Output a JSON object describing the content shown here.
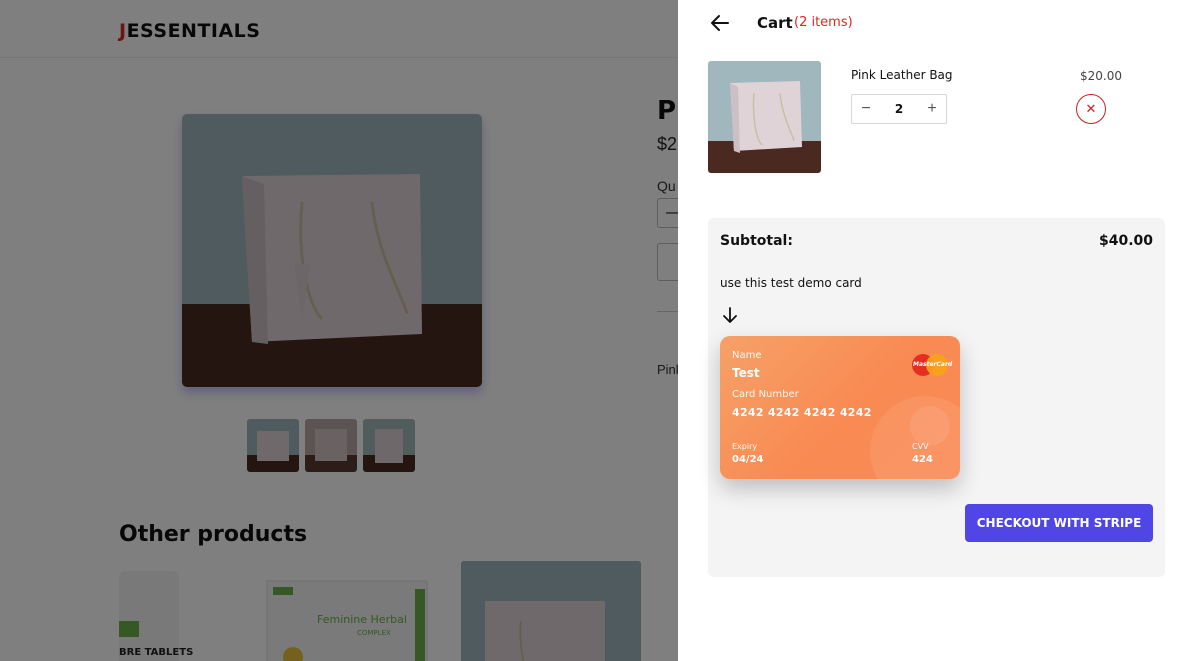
{
  "background_page": {
    "logo_first_letter": "J",
    "logo_rest": "ESSENTIALS",
    "product_title_partial": "Pi",
    "product_price_partial": "$2",
    "quantity_label_partial": "Qu",
    "qty_minus_partial": "—",
    "description_partial": "Pink",
    "other_products_title": "Other products",
    "card_b_product_text": "Feminine Herbal",
    "card_b_product_sub": "COMPLEX",
    "card_a_product_text": "BRE TABLETS"
  },
  "cart": {
    "heading": "Cart",
    "count_text": "(2 items)",
    "item": {
      "name": "Pink Leather Bag",
      "price": "$20.00",
      "quantity": "2",
      "minus_symbol": "−",
      "plus_symbol": "+",
      "remove_symbol": "✕"
    },
    "subtotal_label": "Subtotal:",
    "subtotal_value": "$40.00",
    "demo_text": "use this test demo card",
    "card": {
      "name_label": "Name",
      "name": "Test",
      "number_label": "Card Number",
      "number": "4242 4242 4242 4242",
      "expiry_label": "Expiry",
      "expiry": "04/24",
      "cvv_label": "CVV",
      "cvv": "424",
      "brand": "MasterCard"
    },
    "checkout_label": "CHECKOUT WITH STRIPE"
  },
  "colors": {
    "accent": "#4f46e5",
    "danger": "#e02424",
    "card_orange": "#f88a52"
  }
}
